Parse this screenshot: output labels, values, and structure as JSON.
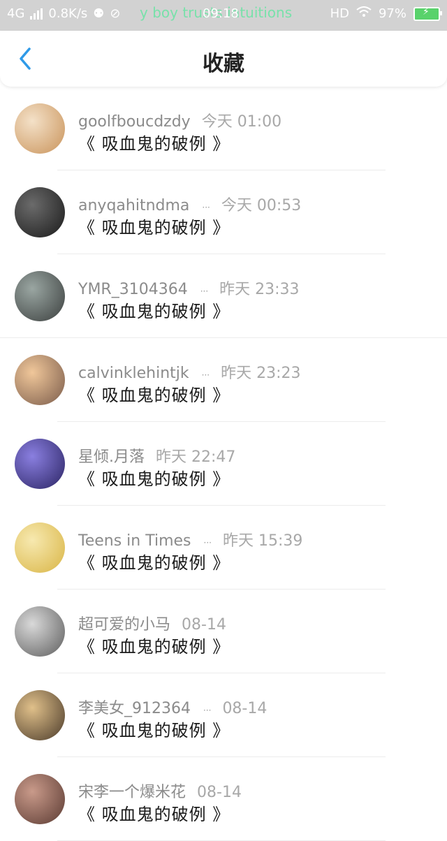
{
  "status_bar": {
    "network": "4G",
    "speed": "0.8K/s",
    "time": "09:18",
    "overlay_text": "y boy trusts intuitions",
    "hd": "HD",
    "battery": "97%"
  },
  "header": {
    "title": "收藏",
    "back_icon": "chevron-left-icon",
    "accent": "#2f9ae8"
  },
  "items": [
    {
      "name": "goolfboucdzdy",
      "truncated": "",
      "time": "今天 01:00",
      "title": "《 吸血鬼的破例 》",
      "avatar_colors": [
        "#f4e1c8",
        "#c9935a"
      ]
    },
    {
      "name": "anyqahitndma",
      "truncated": "···",
      "time": "今天 00:53",
      "title": "《 吸血鬼的破例 》",
      "avatar_colors": [
        "#6b6b6b",
        "#1a1a1a"
      ]
    },
    {
      "name": "YMR_3104364",
      "truncated": "···",
      "time": "昨天 23:33",
      "title": "《 吸血鬼的破例 》",
      "avatar_colors": [
        "#9aa6a2",
        "#3b3f3e"
      ]
    },
    {
      "name": "calvinklehintjk",
      "truncated": "···",
      "time": "昨天 23:23",
      "title": "《 吸血鬼的破例 》",
      "avatar_colors": [
        "#f0c79a",
        "#7a5b4a"
      ]
    },
    {
      "name": "星倾.月落",
      "truncated": "",
      "time": "昨天 22:47",
      "title": "《 吸血鬼的破例 》",
      "avatar_colors": [
        "#8a7fe0",
        "#2b2463"
      ]
    },
    {
      "name": "Teens in Times",
      "truncated": "···",
      "time": "昨天 15:39",
      "title": "《 吸血鬼的破例 》",
      "avatar_colors": [
        "#f7e9b0",
        "#d9b545"
      ]
    },
    {
      "name": "超可爱的小马",
      "truncated": "",
      "time": "08-14",
      "title": "《 吸血鬼的破例 》",
      "avatar_colors": [
        "#d9d9d9",
        "#5d5d5d"
      ]
    },
    {
      "name": "李美女_912364",
      "truncated": "···",
      "time": "08-14",
      "title": "《 吸血鬼的破例 》",
      "avatar_colors": [
        "#e0c08a",
        "#4a3a2a"
      ]
    },
    {
      "name": "宋李一个爆米花",
      "truncated": "",
      "time": "08-14",
      "title": "《 吸血鬼的破例 》",
      "avatar_colors": [
        "#c99a8a",
        "#5a3a32"
      ]
    }
  ]
}
